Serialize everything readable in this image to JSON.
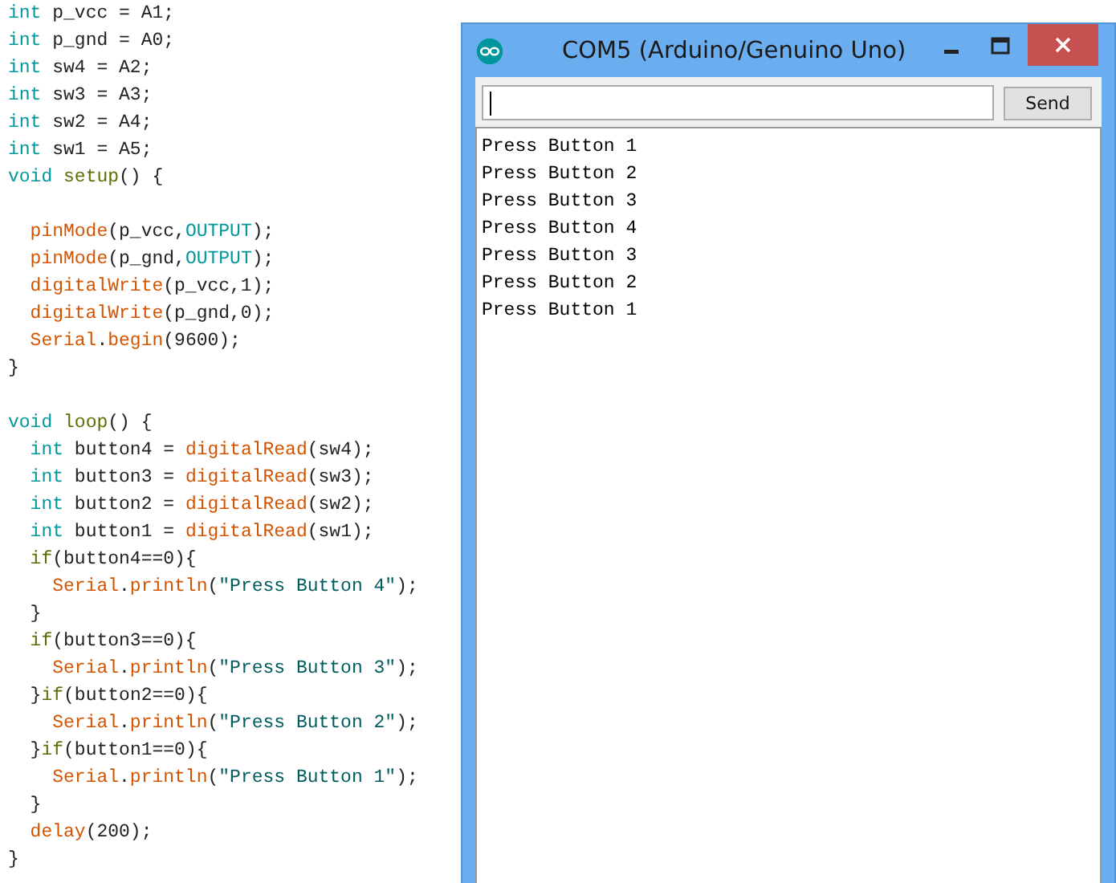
{
  "code": {
    "lines": [
      {
        "kind": "code",
        "tokens": [
          {
            "kind": "type",
            "text": "int"
          },
          {
            "kind": "plain",
            "text": " p_vcc = A1;"
          }
        ]
      },
      {
        "kind": "code",
        "tokens": [
          {
            "kind": "type",
            "text": "int"
          },
          {
            "kind": "plain",
            "text": " p_gnd = A0;"
          }
        ]
      },
      {
        "kind": "code",
        "tokens": [
          {
            "kind": "type",
            "text": "int"
          },
          {
            "kind": "plain",
            "text": " sw4 = A2;"
          }
        ]
      },
      {
        "kind": "code",
        "tokens": [
          {
            "kind": "type",
            "text": "int"
          },
          {
            "kind": "plain",
            "text": " sw3 = A3;"
          }
        ]
      },
      {
        "kind": "code",
        "tokens": [
          {
            "kind": "type",
            "text": "int"
          },
          {
            "kind": "plain",
            "text": " sw2 = A4;"
          }
        ]
      },
      {
        "kind": "code",
        "tokens": [
          {
            "kind": "type",
            "text": "int"
          },
          {
            "kind": "plain",
            "text": " sw1 = A5;"
          }
        ]
      },
      {
        "kind": "code",
        "tokens": [
          {
            "kind": "type",
            "text": "void"
          },
          {
            "kind": "keyword",
            "text": " setup"
          },
          {
            "kind": "plain",
            "text": "() {"
          }
        ]
      },
      {
        "kind": "blank"
      },
      {
        "kind": "code",
        "tokens": [
          {
            "kind": "function",
            "text": "  pinMode"
          },
          {
            "kind": "plain",
            "text": "(p_vcc,"
          },
          {
            "kind": "constant",
            "text": "OUTPUT"
          },
          {
            "kind": "plain",
            "text": ");"
          }
        ]
      },
      {
        "kind": "code",
        "tokens": [
          {
            "kind": "function",
            "text": "  pinMode"
          },
          {
            "kind": "plain",
            "text": "(p_gnd,"
          },
          {
            "kind": "constant",
            "text": "OUTPUT"
          },
          {
            "kind": "plain",
            "text": ");"
          }
        ]
      },
      {
        "kind": "code",
        "tokens": [
          {
            "kind": "function",
            "text": "  digitalWrite"
          },
          {
            "kind": "plain",
            "text": "(p_vcc,1);"
          }
        ]
      },
      {
        "kind": "code",
        "tokens": [
          {
            "kind": "function",
            "text": "  digitalWrite"
          },
          {
            "kind": "plain",
            "text": "(p_gnd,0);"
          }
        ]
      },
      {
        "kind": "code",
        "tokens": [
          {
            "kind": "function",
            "text": "  Serial"
          },
          {
            "kind": "plain",
            "text": "."
          },
          {
            "kind": "function",
            "text": "begin"
          },
          {
            "kind": "plain",
            "text": "(9600);"
          }
        ]
      },
      {
        "kind": "code",
        "tokens": [
          {
            "kind": "plain",
            "text": "}"
          }
        ]
      },
      {
        "kind": "blank"
      },
      {
        "kind": "code",
        "tokens": [
          {
            "kind": "type",
            "text": "void"
          },
          {
            "kind": "keyword",
            "text": " loop"
          },
          {
            "kind": "plain",
            "text": "() {"
          }
        ]
      },
      {
        "kind": "code",
        "tokens": [
          {
            "kind": "type",
            "text": "  int"
          },
          {
            "kind": "plain",
            "text": " button4 = "
          },
          {
            "kind": "function",
            "text": "digitalRead"
          },
          {
            "kind": "plain",
            "text": "(sw4);"
          }
        ]
      },
      {
        "kind": "code",
        "tokens": [
          {
            "kind": "type",
            "text": "  int"
          },
          {
            "kind": "plain",
            "text": " button3 = "
          },
          {
            "kind": "function",
            "text": "digitalRead"
          },
          {
            "kind": "plain",
            "text": "(sw3);"
          }
        ]
      },
      {
        "kind": "code",
        "tokens": [
          {
            "kind": "type",
            "text": "  int"
          },
          {
            "kind": "plain",
            "text": " button2 = "
          },
          {
            "kind": "function",
            "text": "digitalRead"
          },
          {
            "kind": "plain",
            "text": "(sw2);"
          }
        ]
      },
      {
        "kind": "code",
        "tokens": [
          {
            "kind": "type",
            "text": "  int"
          },
          {
            "kind": "plain",
            "text": " button1 = "
          },
          {
            "kind": "function",
            "text": "digitalRead"
          },
          {
            "kind": "plain",
            "text": "(sw1);"
          }
        ]
      },
      {
        "kind": "code",
        "tokens": [
          {
            "kind": "keyword",
            "text": "  if"
          },
          {
            "kind": "plain",
            "text": "(button4==0){"
          }
        ]
      },
      {
        "kind": "code",
        "tokens": [
          {
            "kind": "function",
            "text": "    Serial"
          },
          {
            "kind": "plain",
            "text": "."
          },
          {
            "kind": "function",
            "text": "println"
          },
          {
            "kind": "plain",
            "text": "("
          },
          {
            "kind": "string",
            "text": "\"Press Button 4\""
          },
          {
            "kind": "plain",
            "text": ");"
          }
        ]
      },
      {
        "kind": "code",
        "tokens": [
          {
            "kind": "plain",
            "text": "  }"
          }
        ]
      },
      {
        "kind": "code",
        "tokens": [
          {
            "kind": "keyword",
            "text": "  if"
          },
          {
            "kind": "plain",
            "text": "(button3==0){"
          }
        ]
      },
      {
        "kind": "code",
        "tokens": [
          {
            "kind": "function",
            "text": "    Serial"
          },
          {
            "kind": "plain",
            "text": "."
          },
          {
            "kind": "function",
            "text": "println"
          },
          {
            "kind": "plain",
            "text": "("
          },
          {
            "kind": "string",
            "text": "\"Press Button 3\""
          },
          {
            "kind": "plain",
            "text": ");"
          }
        ]
      },
      {
        "kind": "code",
        "tokens": [
          {
            "kind": "plain",
            "text": "  }"
          },
          {
            "kind": "keyword",
            "text": "if"
          },
          {
            "kind": "plain",
            "text": "(button2==0){"
          }
        ]
      },
      {
        "kind": "code",
        "tokens": [
          {
            "kind": "function",
            "text": "    Serial"
          },
          {
            "kind": "plain",
            "text": "."
          },
          {
            "kind": "function",
            "text": "println"
          },
          {
            "kind": "plain",
            "text": "("
          },
          {
            "kind": "string",
            "text": "\"Press Button 2\""
          },
          {
            "kind": "plain",
            "text": ");"
          }
        ]
      },
      {
        "kind": "code",
        "tokens": [
          {
            "kind": "plain",
            "text": "  }"
          },
          {
            "kind": "keyword",
            "text": "if"
          },
          {
            "kind": "plain",
            "text": "(button1==0){"
          }
        ]
      },
      {
        "kind": "code",
        "tokens": [
          {
            "kind": "function",
            "text": "    Serial"
          },
          {
            "kind": "plain",
            "text": "."
          },
          {
            "kind": "function",
            "text": "println"
          },
          {
            "kind": "plain",
            "text": "("
          },
          {
            "kind": "string",
            "text": "\"Press Button 1\""
          },
          {
            "kind": "plain",
            "text": ");"
          }
        ]
      },
      {
        "kind": "code",
        "tokens": [
          {
            "kind": "plain",
            "text": "  }"
          }
        ]
      },
      {
        "kind": "code",
        "tokens": [
          {
            "kind": "function",
            "text": "  delay"
          },
          {
            "kind": "plain",
            "text": "(200);"
          }
        ]
      },
      {
        "kind": "code",
        "tokens": [
          {
            "kind": "plain",
            "text": "}"
          }
        ]
      }
    ]
  },
  "window": {
    "title": "COM5 (Arduino/Genuino Uno)",
    "send_button": "Send",
    "output": [
      "Press Button 1",
      "Press Button 2",
      "Press Button 3",
      "Press Button 4",
      "Press Button 3",
      "Press Button 2",
      "Press Button 1"
    ]
  }
}
